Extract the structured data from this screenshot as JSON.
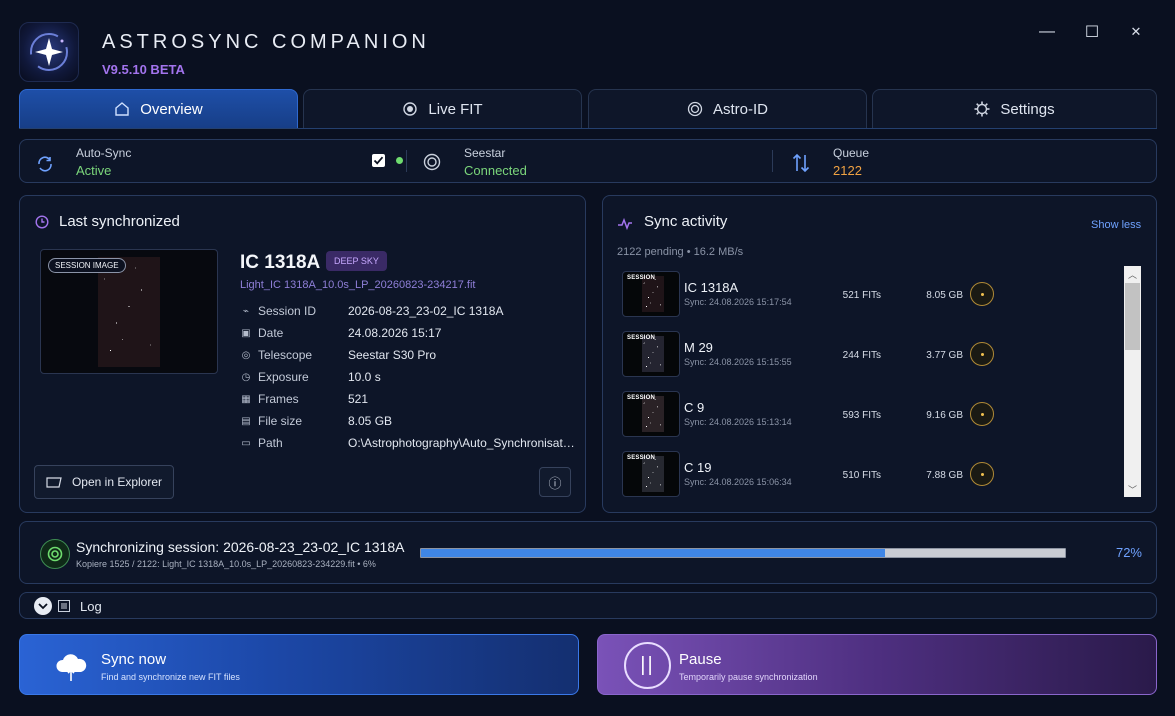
{
  "app": {
    "title": "ASTROSYNC COMPANION",
    "version": "V9.5.10 BETA"
  },
  "window_controls": {
    "minimize": "—",
    "maximize": "☐",
    "close": "✕"
  },
  "tabs": [
    {
      "label": "Overview",
      "icon": "home-icon",
      "active": true
    },
    {
      "label": "Live FIT",
      "icon": "radio-icon",
      "active": false
    },
    {
      "label": "Astro-ID",
      "icon": "target-icon",
      "active": false
    },
    {
      "label": "Settings",
      "icon": "gear-icon",
      "active": false
    }
  ],
  "status": {
    "autosync": {
      "label": "Auto-Sync",
      "value": "Active",
      "checked": true
    },
    "seestar": {
      "label": "Seestar",
      "value": "Connected"
    },
    "queue": {
      "label": "Queue",
      "value": "2122"
    }
  },
  "last_sync": {
    "title": "Last synchronized",
    "image_tag": "SESSION IMAGE",
    "object": "IC 1318A",
    "badge": "DEEP SKY",
    "filename": "Light_IC 1318A_10.0s_LP_20260823-234217.fit",
    "fields": [
      {
        "key": "Session ID",
        "value": "2026-08-23_23-02_IC 1318A",
        "icon": "wave-icon"
      },
      {
        "key": "Date",
        "value": "24.08.2026 15:17",
        "icon": "calendar-icon"
      },
      {
        "key": "Telescope",
        "value": "Seestar S30 Pro",
        "icon": "telescope-icon"
      },
      {
        "key": "Exposure",
        "value": "10.0 s",
        "icon": "clock-icon"
      },
      {
        "key": "Frames",
        "value": "521",
        "icon": "frames-icon"
      },
      {
        "key": "File size",
        "value": "8.05 GB",
        "icon": "disk-icon"
      },
      {
        "key": "Path",
        "value": "O:\\Astrophotography\\Auto_Synchronisati...",
        "icon": "folder-icon"
      }
    ],
    "open_button": "Open in Explorer",
    "info_button": "ⓘ"
  },
  "activity": {
    "title": "Sync activity",
    "toggle": "Show less",
    "summary": "2122 pending • 16.2 MB/s",
    "thumb_tag": "SESSION",
    "items": [
      {
        "name": "IC 1318A",
        "sync": "Sync: 24.08.2026 15:17:54",
        "fits": "521 FITs",
        "size": "8.05 GB"
      },
      {
        "name": "M 29",
        "sync": "Sync: 24.08.2026 15:15:55",
        "fits": "244 FITs",
        "size": "3.77 GB"
      },
      {
        "name": "C 9",
        "sync": "Sync: 24.08.2026 15:13:14",
        "fits": "593 FITs",
        "size": "9.16 GB"
      },
      {
        "name": "C 19",
        "sync": "Sync: 24.08.2026 15:06:34",
        "fits": "510 FITs",
        "size": "7.88 GB"
      }
    ]
  },
  "progress": {
    "title": "Synchronizing session: 2026-08-23_23-02_IC 1318A",
    "detail": "Kopiere 1525 / 2122: Light_IC 1318A_10.0s_LP_20260823-234229.fit • 6%",
    "percent_label": "72%",
    "fraction": 0.72
  },
  "log": {
    "label": "Log"
  },
  "actions": {
    "sync": {
      "title": "Sync now",
      "subtitle": "Find and synchronize new FIT files"
    },
    "pause": {
      "title": "Pause",
      "subtitle": "Temporarily pause synchronization",
      "glyph": "||"
    }
  },
  "colors": {
    "accent_blue": "#2f69cf",
    "active_green": "#7bd67b",
    "queue_orange": "#f0a243",
    "brand_purple": "#a374ee"
  }
}
